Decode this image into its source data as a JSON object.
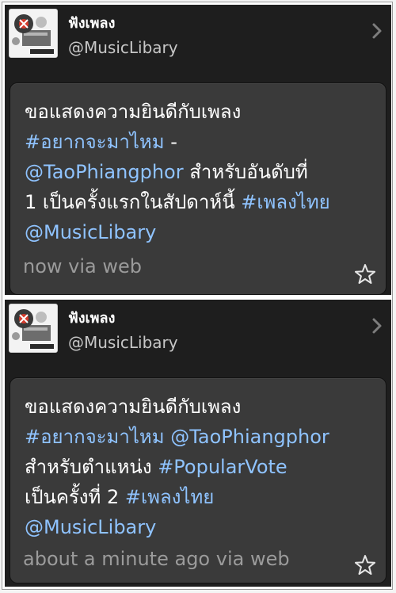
{
  "tweets": [
    {
      "user": {
        "name": "ฟังเพลง",
        "handle": "@MusicLibary"
      },
      "lines": [
        [
          {
            "t": "ขอแสดงความยินดีกับเพลง",
            "hl": false
          }
        ],
        [
          {
            "t": "#อยากจะมาไหม",
            "hl": true
          },
          {
            "t": " -",
            "hl": false
          }
        ],
        [
          {
            "t": "@TaoPhiangphor",
            "hl": true
          },
          {
            "t": " สำหรับอันดับที่",
            "hl": false
          }
        ],
        [
          {
            "t": "1 เป็นครั้งแรกในสัปดาห์นี้ ",
            "hl": false
          },
          {
            "t": "#เพลงไทย",
            "hl": true
          }
        ],
        [
          {
            "t": "@MusicLibary",
            "hl": true
          }
        ]
      ],
      "meta": "now via web"
    },
    {
      "user": {
        "name": "ฟังเพลง",
        "handle": "@MusicLibary"
      },
      "lines": [
        [
          {
            "t": "ขอแสดงความยินดีกับเพลง",
            "hl": false
          }
        ],
        [
          {
            "t": "#อยากจะมาไหม",
            "hl": true
          },
          {
            "t": " ",
            "hl": false
          },
          {
            "t": "@TaoPhiangphor",
            "hl": true
          }
        ],
        [
          {
            "t": "สำหรับตำแหน่ง ",
            "hl": false
          },
          {
            "t": "#PopularVote",
            "hl": true
          }
        ],
        [
          {
            "t": "เป็นครั้งที่ 2 ",
            "hl": false
          },
          {
            "t": "#เพลงไทย",
            "hl": true
          }
        ],
        [
          {
            "t": "@MusicLibary",
            "hl": true
          }
        ]
      ],
      "meta": "about a minute ago via web"
    }
  ],
  "icons": {
    "avatar": "music-logo-avatar",
    "chevron": "chevron-right-icon",
    "favorite": "star-outline-icon"
  },
  "colors": {
    "panel_bg": "#1e1e1e",
    "bubble_bg": "#3a3a3a",
    "link": "#8fc3ff",
    "meta_text": "#9b9b9b"
  }
}
